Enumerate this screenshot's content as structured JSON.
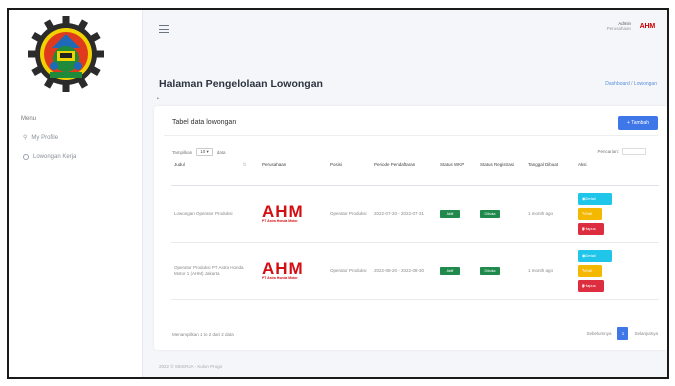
{
  "sidebar": {
    "section_title": "Menu",
    "items": [
      {
        "icon": "user-icon",
        "label": "My Profile"
      },
      {
        "icon": "circle-icon",
        "label": "Lowongan Kerja"
      }
    ]
  },
  "header": {
    "user_name": "Admin",
    "user_role": "Perusahaan",
    "avatar_text": "AHM"
  },
  "page": {
    "title": "Halaman Pengelolaan Lowongan",
    "breadcrumb": [
      "Dashboard",
      "Lowongan"
    ],
    "dot": "•"
  },
  "card": {
    "title": "Tabel data lowongan",
    "add_button": "+ Tambah",
    "show_label": "Tampilkan",
    "show_value": "10",
    "entries_label": "data",
    "search_label": "Pencarian:",
    "columns": [
      "Judul",
      "Perusahaan",
      "Posisi",
      "Periode Pendaftaran",
      "Status WKP",
      "Status Registrasi",
      "Tanggal Dibuat",
      "Aksi"
    ],
    "rows": [
      {
        "judul": "Lowongan Operator Produksi",
        "company_logo_big": "AHM",
        "company_logo_small": "PT Astra Honda Motor",
        "posisi": "Operator Produksi",
        "periode": "2022-07-20 - 2022-07-31",
        "status_wkp": "Aktif",
        "status_reg": "Dibuka",
        "tanggal": "1 month ago"
      },
      {
        "judul": "Operator Produksi PT Astra Honda Motor 1 (AHM) Jakarta",
        "company_logo_big": "AHM",
        "company_logo_small": "PT Astra Honda Motor",
        "posisi": "Operator Produksi",
        "periode": "2022-08-20 - 2022-08-30",
        "status_wkp": "Aktif",
        "status_reg": "Dibuka",
        "tanggal": "1 month ago"
      }
    ],
    "action_labels": {
      "detail": "Detail",
      "edit": "Edit",
      "delete": "Hapus"
    },
    "info": "Menampilkan 1 to 2 dari 2 data",
    "pager": {
      "prev": "Sebelumnya",
      "current": "1",
      "next": "Selanjutnya"
    }
  },
  "footer": "2022 © SIKERJA - Kulon Progo",
  "colors": {
    "primary": "#3f76e8",
    "success": "#1f8a4c",
    "info": "#1fc6ea",
    "warning": "#f5b800",
    "danger": "#dc2e3f",
    "brand_red": "#d40f14"
  }
}
